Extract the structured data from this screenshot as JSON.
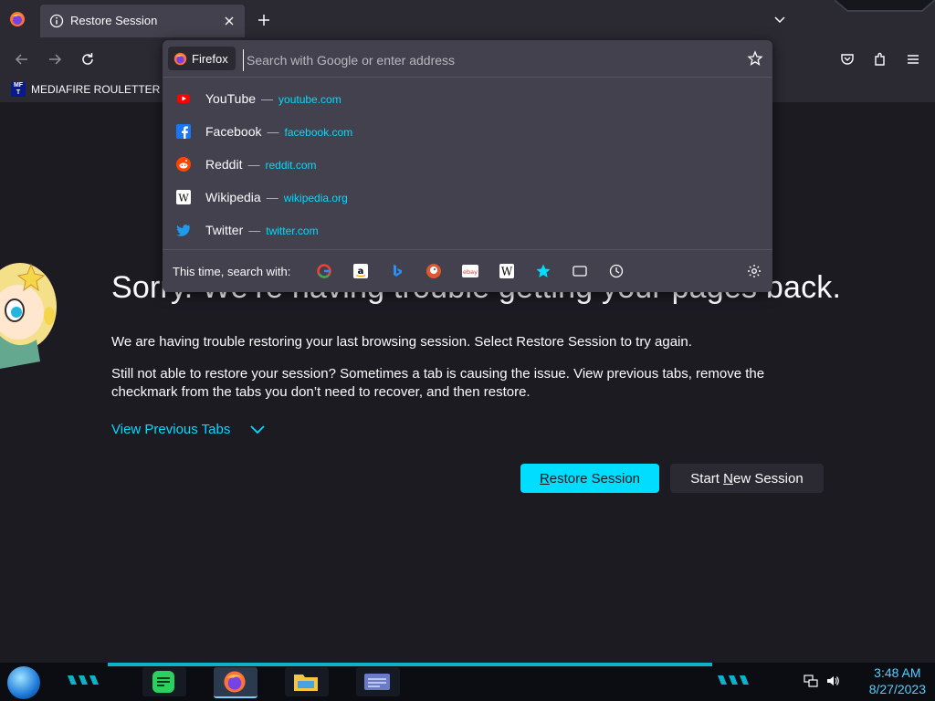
{
  "tab": {
    "title": "Restore Session"
  },
  "bookmarks": [
    {
      "label": "MEDIAFIRE ROULETTER",
      "icon_text": "MF T"
    }
  ],
  "urlbar": {
    "identity_label": "Firefox",
    "placeholder": "Search with Google or enter address"
  },
  "suggestions": [
    {
      "name": "YouTube",
      "url": "youtube.com",
      "icon": "youtube-icon",
      "color": "#ff0000"
    },
    {
      "name": "Facebook",
      "url": "facebook.com",
      "icon": "facebook-icon",
      "color": "#1877f2"
    },
    {
      "name": "Reddit",
      "url": "reddit.com",
      "icon": "reddit-icon",
      "color": "#ff4500"
    },
    {
      "name": "Wikipedia",
      "url": "wikipedia.org",
      "icon": "wikipedia-icon",
      "color": "#ffffff"
    },
    {
      "name": "Twitter",
      "url": "twitter.com",
      "icon": "twitter-icon",
      "color": "#1d9bf0"
    }
  ],
  "search_with_label": "This time, search with:",
  "search_engines": [
    "google",
    "amazon",
    "bing",
    "duckduckgo",
    "ebay",
    "wikipedia",
    "bookmarks",
    "tabs",
    "history"
  ],
  "page": {
    "headline": "Sorry. We’re having trouble getting your pages back.",
    "para1": "We are having trouble restoring your last browsing session. Select Restore Session to try again.",
    "para2": "Still not able to restore your session? Sometimes a tab is causing the issue. View previous tabs, remove the checkmark from the tabs you don’t need to recover, and then restore.",
    "view_previous": "View Previous Tabs",
    "restore_button": {
      "before": "",
      "underlined": "R",
      "after": "estore Session"
    },
    "new_session_button": {
      "before": "Start ",
      "underlined": "N",
      "after": "ew Session"
    }
  },
  "taskbar": {
    "time": "3:48 AM",
    "date": "8/27/2023"
  },
  "colors": {
    "accent": "#00ddff",
    "panel": "#42414d",
    "chrome": "#2b2a33",
    "page": "#1c1b22"
  }
}
